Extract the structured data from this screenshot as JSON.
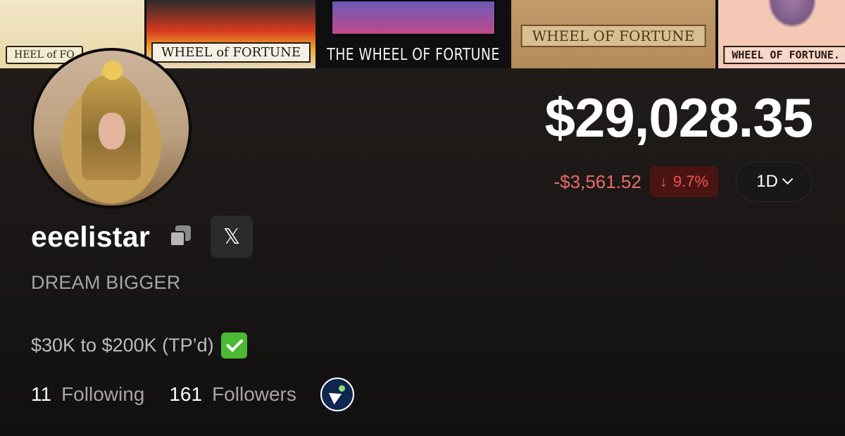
{
  "banner": {
    "cards": [
      {
        "label": "HEEL of FO"
      },
      {
        "label": "WHEEL of FORTUNE"
      },
      {
        "label": "THE WHEEL OF FORTUNE"
      },
      {
        "label": "WHEEL OF FORTUNE"
      },
      {
        "label": "WHEEL OF FORTUNE."
      }
    ]
  },
  "profile": {
    "username": "eeelistar",
    "bio": "DREAM BIGGER",
    "tagline": "$30K to $200K (TP’d)",
    "x_icon_glyph": "𝕏"
  },
  "portfolio": {
    "balance": "$29,028.35",
    "change_amount": "-$3,561.52",
    "change_arrow": "↓",
    "change_percent": "9.7%",
    "period": "1D"
  },
  "stats": {
    "following_count": "11",
    "following_label": "Following",
    "followers_count": "161",
    "followers_label": "Followers"
  },
  "colors": {
    "negative": "#ea6a66",
    "negative_badge_bg": "#4a1412",
    "check_green": "#4cb935"
  },
  "icons": [
    "copy-icon",
    "x-logo-icon",
    "chevron-down-icon",
    "check-icon",
    "megaphone-badge-icon"
  ]
}
